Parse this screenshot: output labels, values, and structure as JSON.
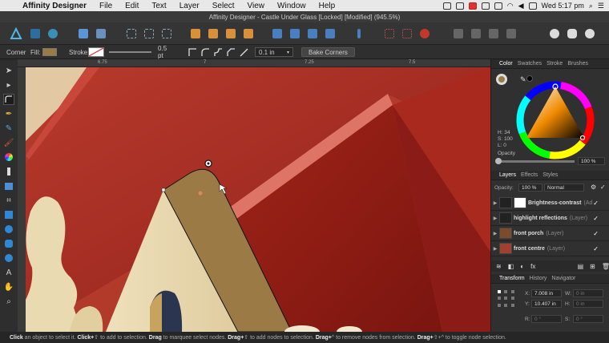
{
  "menubar": {
    "app_name": "Affinity Designer",
    "items": [
      "File",
      "Edit",
      "Text",
      "Layer",
      "Select",
      "View",
      "Window",
      "Help"
    ],
    "clock": "Wed 5:17 pm"
  },
  "titlebar": {
    "title": "Affinity Designer - Castle Under Glass [Locked] [Modified] (945.5%)"
  },
  "context": {
    "mode_label": "Corner",
    "fill_label": "Fill:",
    "fill_color": "#9c7a45",
    "stroke_label": "Stroke:",
    "stroke_width": "0.5 pt",
    "corner_radius": "0.1 in",
    "bake_label": "Bake Corners"
  },
  "ruler": {
    "labels": [
      "6.75",
      "7",
      "7.25",
      "7.5"
    ]
  },
  "status": {
    "t1": "Click",
    "t2": " an object to select it. ",
    "t3": "Click+",
    "t4": " to add to selection. ",
    "t5": "Drag",
    "t6": " to marquee select nodes. ",
    "t7": "Drag+",
    "t8": " to add nodes to selection. ",
    "t9": "Drag+",
    "t10": " to remove nodes from selection. ",
    "t11": "Drag+",
    "t12": " to toggle node selection."
  },
  "color_panel": {
    "tabs": [
      "Color",
      "Swatches",
      "Stroke",
      "Brushes"
    ],
    "h": "H: 34",
    "s": "S: 100",
    "l": "L: 0",
    "opacity_label": "Opacity",
    "opacity_value": "100 %"
  },
  "layers_panel": {
    "tabs": [
      "Layers",
      "Effects",
      "Styles"
    ],
    "opacity_label": "Opacity:",
    "opacity_value": "100 %",
    "blend_mode": "Normal",
    "rows": [
      {
        "name": "Brightness-contrast",
        "type": "(Ad"
      },
      {
        "name": "highlight reflections",
        "type": "(Layer)"
      },
      {
        "name": "front porch",
        "type": "(Layer)"
      },
      {
        "name": "front centre",
        "type": "(Layer)"
      }
    ]
  },
  "transform_panel": {
    "tabs": [
      "Transform",
      "History",
      "Navigator"
    ],
    "x_label": "X:",
    "x_value": "7.008 in",
    "y_label": "Y:",
    "y_value": "10.407 in",
    "w_label": "W:",
    "w_value": "0 in",
    "h_label": "H:",
    "h_value": "0 in",
    "r_label": "R:",
    "r_value": "0 °",
    "s_label": "S:",
    "s_value": "0 °"
  }
}
